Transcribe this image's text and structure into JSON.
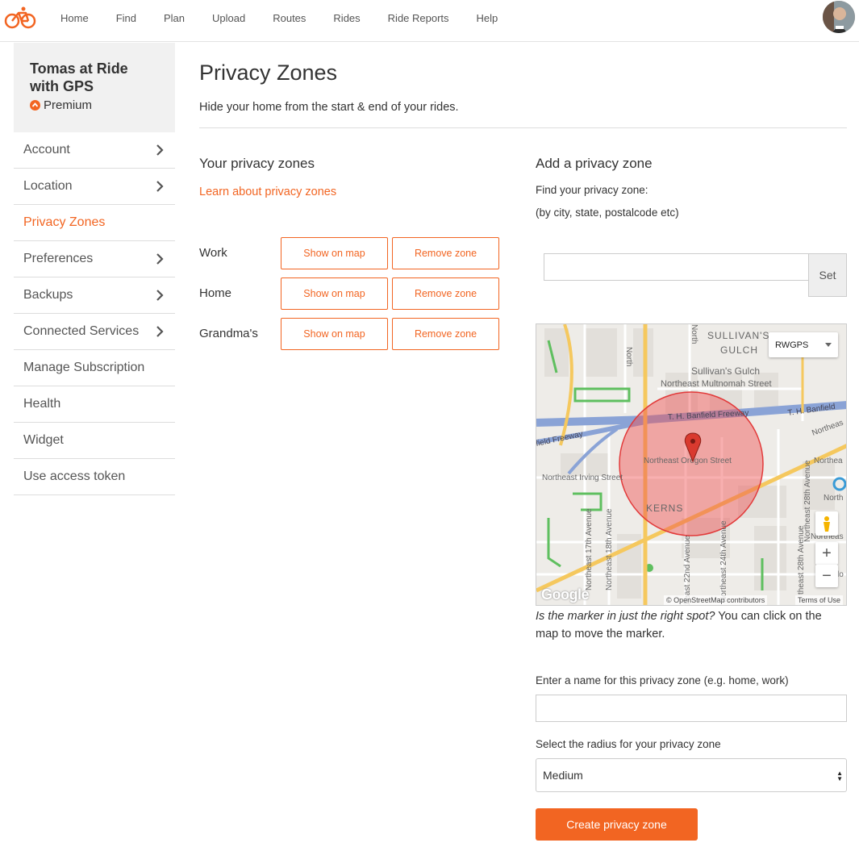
{
  "nav": {
    "items": [
      "Home",
      "Find",
      "Plan",
      "Upload",
      "Routes",
      "Rides",
      "Ride Reports",
      "Help"
    ]
  },
  "account": {
    "name": "Tomas at Ride with GPS",
    "plan": "Premium"
  },
  "sidebar": {
    "items": [
      {
        "label": "Account",
        "chevron": true
      },
      {
        "label": "Location",
        "chevron": true
      },
      {
        "label": "Privacy Zones",
        "chevron": false,
        "active": true
      },
      {
        "label": "Preferences",
        "chevron": true
      },
      {
        "label": "Backups",
        "chevron": true
      },
      {
        "label": "Connected Services",
        "chevron": true
      },
      {
        "label": "Manage Subscription",
        "chevron": false
      },
      {
        "label": "Health",
        "chevron": false
      },
      {
        "label": "Widget",
        "chevron": false
      },
      {
        "label": "Use access token",
        "chevron": false
      }
    ]
  },
  "page": {
    "title": "Privacy Zones",
    "subtitle": "Hide your home from the start & end of your rides."
  },
  "zones": {
    "heading": "Your privacy zones",
    "learn_link": "Learn about privacy zones",
    "show_label": "Show on map",
    "remove_label": "Remove zone",
    "items": [
      "Work",
      "Home",
      "Grandma's"
    ]
  },
  "add": {
    "heading": "Add a privacy zone",
    "find_label": "Find your privacy zone:",
    "find_hint": "(by city, state, postalcode etc)",
    "find_value": "",
    "set_label": "Set",
    "hint_italic": "Is the marker in just the right spot?",
    "hint_rest": " You can click on the map to move the marker.",
    "name_label": "Enter a name for this privacy zone (e.g. home, work)",
    "name_value": "",
    "radius_label": "Select the radius for your privacy zone",
    "radius_value": "Medium",
    "create_label": "Create privacy zone"
  },
  "map": {
    "layer_select": "RWGPS",
    "attribution": "© OpenStreetMap contributors",
    "terms": "Terms of Use",
    "google": "Google",
    "labels": {
      "sullivans_gulch_upper": "SULLIVAN'S",
      "gulch_upper": "GULCH",
      "sullivans_gulch": "Sullivan's Gulch",
      "multnomah": "Northeast Multnomah Street",
      "banfield": "T. H. Banfield Freeway",
      "banfield2": "T. H. Banfield",
      "freeway": "field Freeway",
      "oregon": "Northeast Oregon Street",
      "irving": "Northeast Irving Street",
      "kerns": "KERNS",
      "ave17": "Northeast 17th Avenue",
      "ave18": "Northeast 18th Avenue",
      "ave22": "theast 22nd Avenue",
      "ave24": "Northeast 24th Avenue",
      "ave28": "Northeast 28th Avenue",
      "ave28b": "theast 28th Avenue",
      "north1": "North",
      "north2": "North",
      "northea": "Northea",
      "northeas": "Northeas",
      "northeast_right": "Northeas",
      "north_r": "North",
      "lo": "lo"
    }
  },
  "colors": {
    "accent": "#f26522"
  }
}
